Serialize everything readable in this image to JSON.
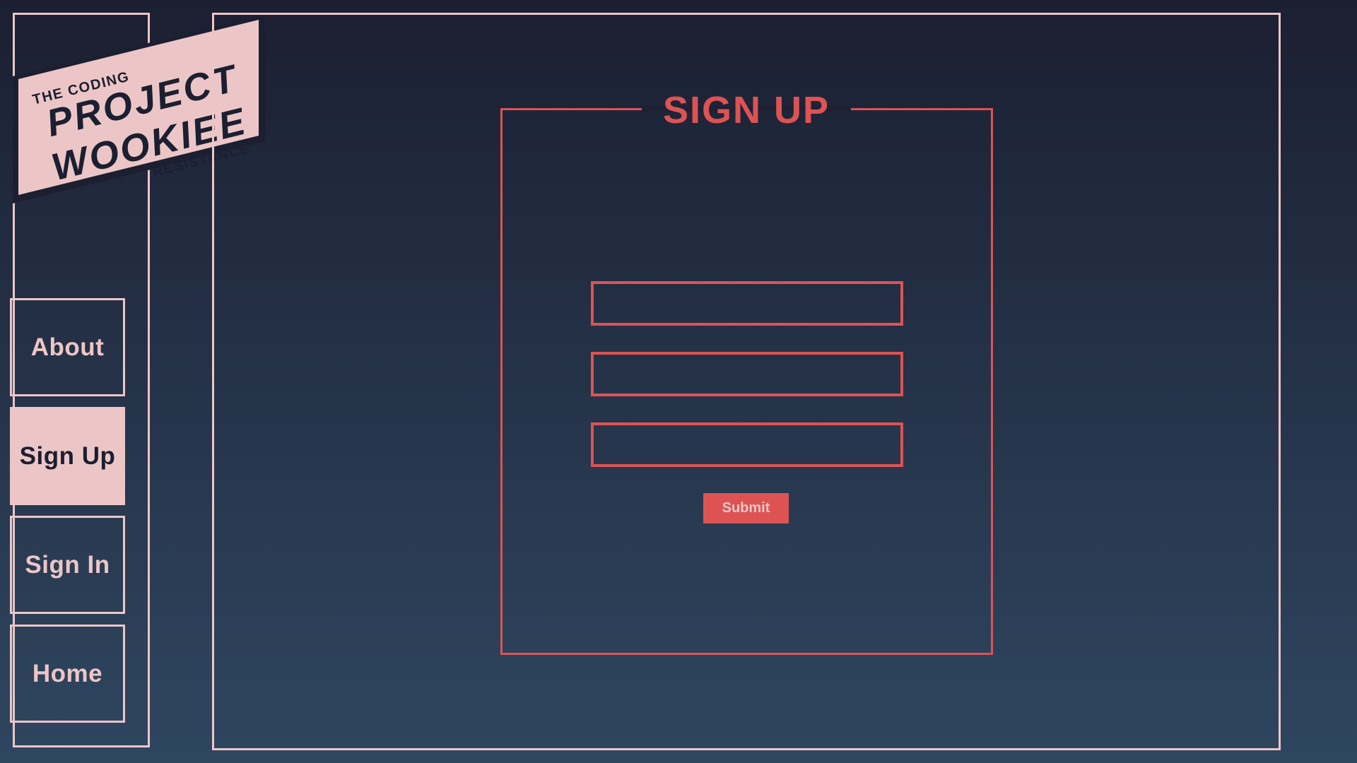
{
  "logo": {
    "top_text": "THE CODING",
    "line1": "PROJECT",
    "line2": "WOOKIEE",
    "bottom_text": "RESISTANCE"
  },
  "nav": {
    "items": [
      {
        "label": "About",
        "active": false
      },
      {
        "label": "Sign Up",
        "active": true
      },
      {
        "label": "Sign In",
        "active": false
      },
      {
        "label": "Home",
        "active": false
      }
    ]
  },
  "signup": {
    "title": "SIGN UP",
    "fields": [
      {
        "value": "",
        "placeholder": ""
      },
      {
        "value": "",
        "placeholder": ""
      },
      {
        "value": "",
        "placeholder": ""
      }
    ],
    "submit_label": "Submit"
  },
  "colors": {
    "accent": "#dd5353",
    "pink": "#ecc6c6",
    "background_top": "#1b1f31",
    "background_bottom": "#2f4660"
  }
}
